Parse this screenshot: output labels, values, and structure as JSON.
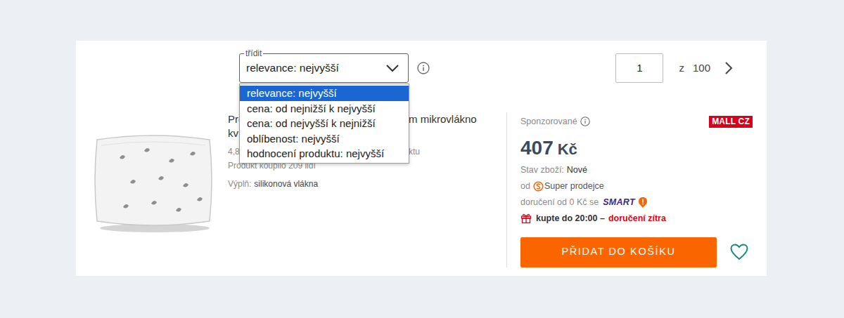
{
  "sort": {
    "label": "třídit",
    "value": "relevance: nejvyšší",
    "expanded": true,
    "options": [
      {
        "label": "relevance: nejvyšší",
        "selected": true
      },
      {
        "label": "cena: od nejnižší k nejvyšší",
        "selected": false
      },
      {
        "label": "cena: od nejvyšší k nejnižší",
        "selected": false
      },
      {
        "label": "oblíbenost: nejvyšší",
        "selected": false
      },
      {
        "label": "hodnocení produktu: nejvyšší",
        "selected": false
      }
    ]
  },
  "pagination": {
    "page": "1",
    "of": "z",
    "total": "100"
  },
  "product": {
    "title": {
      "line1_start": "Pro",
      "line1_end": "m mikrovlákno",
      "line2_start": "kv"
    },
    "rating": {
      "start": "4,8",
      "end": "ktu"
    },
    "purchases": "Produkt koupilo 209 lidí",
    "attributes": [
      {
        "label": "Výplň:",
        "value": "silikonová vlákna"
      }
    ]
  },
  "offer": {
    "sponsored": "Sponzorované",
    "shop": "MALL CZ",
    "price": "407",
    "currency": "Kč",
    "condition_label": "Stav zboží:",
    "condition": "Nové",
    "seller_prefix": "od",
    "seller": "Super prodejce",
    "delivery": "doručení od 0 Kč se",
    "delivery_program": "SMART",
    "deadline": "kupte do 20:00 –",
    "delivery_date": "doručení zítra",
    "button": "PŘIDAT DO KOŠÍKU",
    "favorite": false
  }
}
